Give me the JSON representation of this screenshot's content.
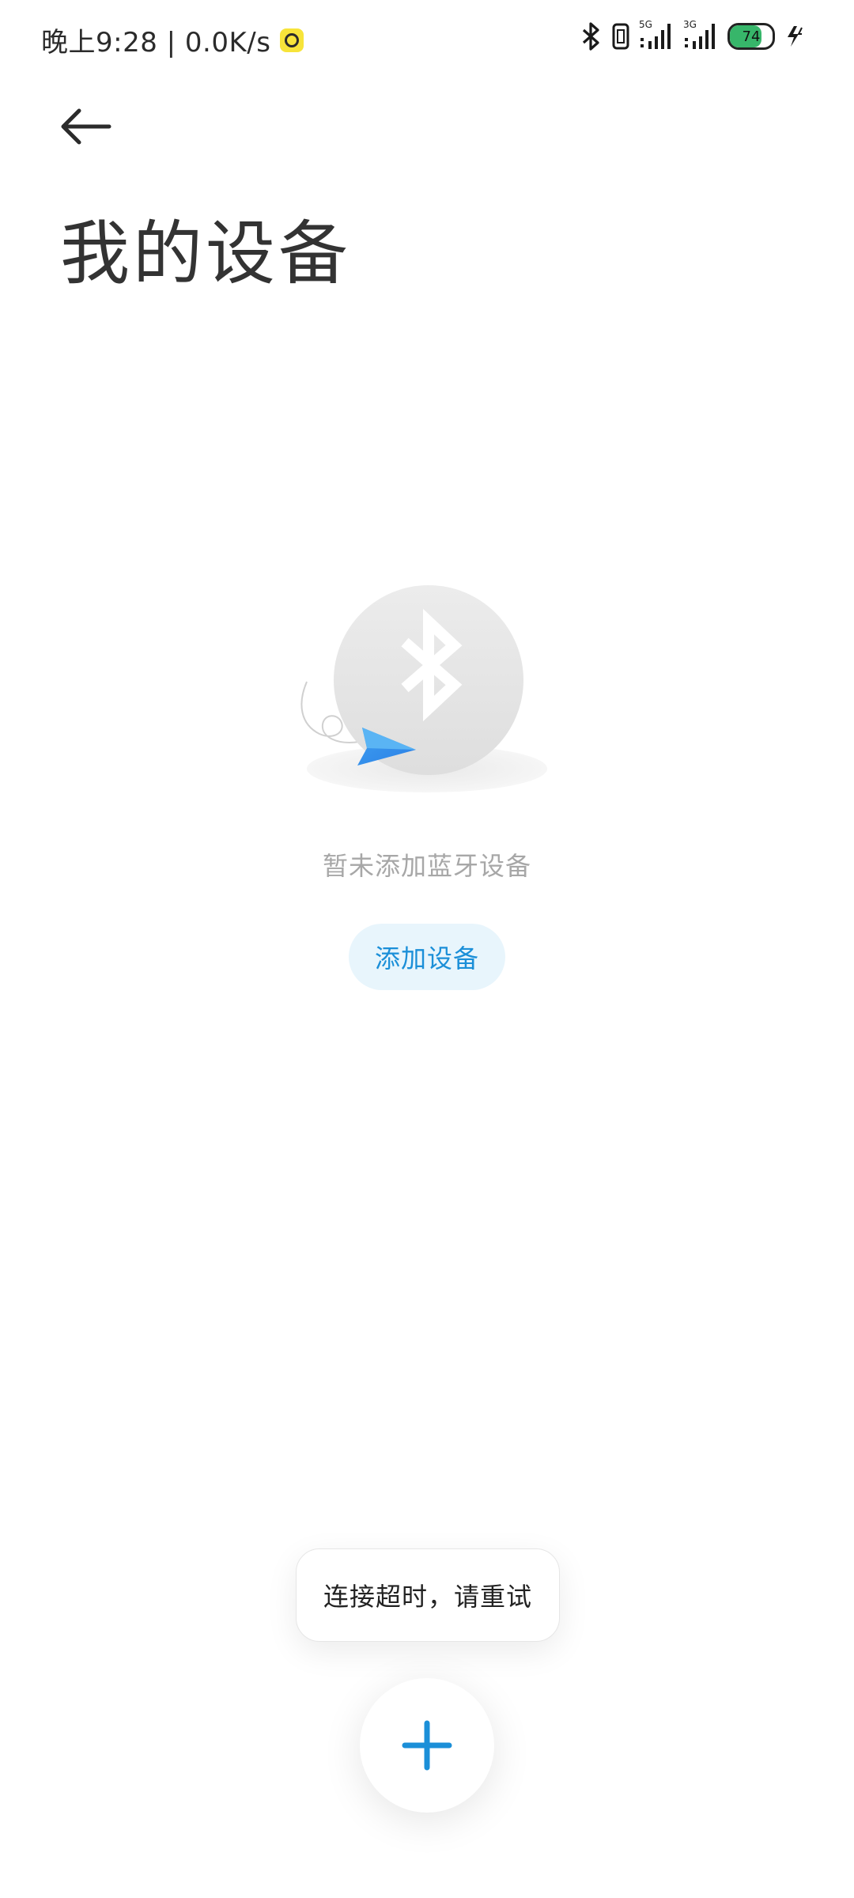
{
  "status_bar": {
    "time_speed": "晚上9:28 | 0.0K/s",
    "network_1": "5G",
    "network_2": "3G",
    "battery_level": "74",
    "battery_color": "#37b66a"
  },
  "header": {
    "title": "我的设备",
    "back_icon": "arrow-left-icon"
  },
  "empty_state": {
    "illustration_icon": "bluetooth-icon",
    "message": "暂未添加蓝牙设备",
    "add_button_label": "添加设备"
  },
  "toast": {
    "message": "连接超时，请重试"
  },
  "fab": {
    "icon": "plus-icon",
    "accent": "#1b8fd8"
  }
}
